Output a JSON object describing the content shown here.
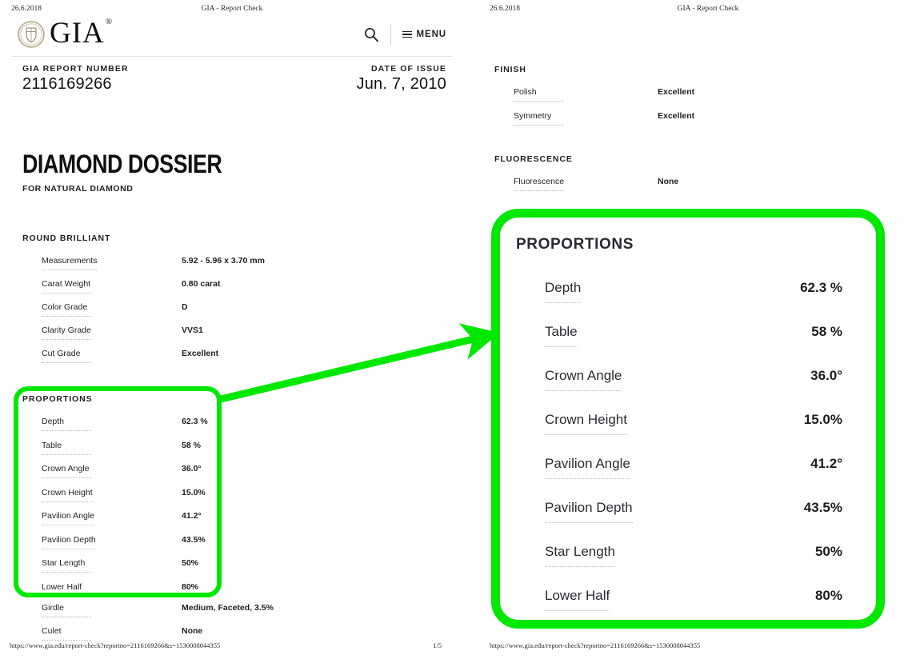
{
  "theme": {
    "highlight_green": "#00e800",
    "text_dark": "#231f20",
    "dotted_rule": "#b9b9b9"
  },
  "print_header": {
    "date": "26.6.2018",
    "title": "GIA - Report Check"
  },
  "print_footer": {
    "url": "https://www.gia.edu/report-check?reportno=2116169266&s=1530008044355",
    "page": "1/5"
  },
  "masthead": {
    "brand": "GIA",
    "brand_mark": "®",
    "seal_icon": "gia-seal-icon",
    "search_icon": "search-icon",
    "menu_icon": "hamburger-menu-icon",
    "menu_label": "MENU"
  },
  "report_meta": {
    "number_label": "GIA REPORT NUMBER",
    "number_value": "2116169266",
    "date_label": "DATE OF ISSUE",
    "date_value": "Jun. 7, 2010"
  },
  "dossier": {
    "title": "DIAMOND DOSSIER",
    "subtitle": "FOR NATURAL DIAMOND"
  },
  "shape_section": {
    "heading": "ROUND BRILLIANT",
    "rows": [
      {
        "label": "Measurements",
        "value": "5.92 - 5.96 x 3.70 mm"
      },
      {
        "label": "Carat Weight",
        "value": "0.80 carat"
      },
      {
        "label": "Color Grade",
        "value": "D"
      },
      {
        "label": "Clarity Grade",
        "value": "VVS1"
      },
      {
        "label": "Cut Grade",
        "value": "Excellent"
      }
    ]
  },
  "proportions_section": {
    "heading": "PROPORTIONS",
    "rows": [
      {
        "label": "Depth",
        "value": "62.3 %"
      },
      {
        "label": "Table",
        "value": "58 %"
      },
      {
        "label": "Crown Angle",
        "value": "36.0°"
      },
      {
        "label": "Crown Height",
        "value": "15.0%"
      },
      {
        "label": "Pavilion Angle",
        "value": "41.2°"
      },
      {
        "label": "Pavilion Depth",
        "value": "43.5%"
      },
      {
        "label": "Star Length",
        "value": "50%"
      },
      {
        "label": "Lower Half",
        "value": "80%"
      }
    ]
  },
  "tail_section": {
    "rows": [
      {
        "label": "Girdle",
        "value": "Medium, Faceted, 3.5%"
      },
      {
        "label": "Culet",
        "value": "None"
      }
    ]
  },
  "finish_section": {
    "heading": "FINISH",
    "rows": [
      {
        "label": "Polish",
        "value": "Excellent"
      },
      {
        "label": "Symmetry",
        "value": "Excellent"
      }
    ]
  },
  "fluorescence_section": {
    "heading": "FLUORESCENCE",
    "rows": [
      {
        "label": "Fluorescence",
        "value": "None"
      }
    ]
  },
  "callout": {
    "heading": "PROPORTIONS",
    "rows": [
      {
        "label": "Depth",
        "value": "62.3 %"
      },
      {
        "label": "Table",
        "value": "58 %"
      },
      {
        "label": "Crown Angle",
        "value": "36.0°"
      },
      {
        "label": "Crown Height",
        "value": "15.0%"
      },
      {
        "label": "Pavilion Angle",
        "value": "41.2°"
      },
      {
        "label": "Pavilion Depth",
        "value": "43.5%"
      },
      {
        "label": "Star Length",
        "value": "50%"
      },
      {
        "label": "Lower Half",
        "value": "80%"
      }
    ]
  }
}
